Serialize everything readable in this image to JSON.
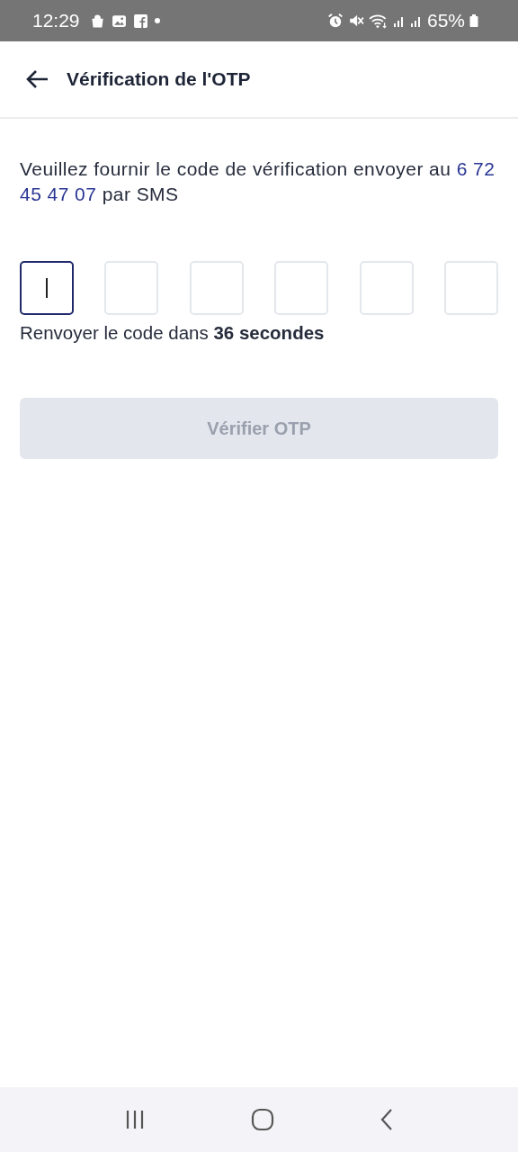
{
  "status_bar": {
    "time": "12:29",
    "battery": "65%"
  },
  "header": {
    "title": "Vérification de l'OTP"
  },
  "message": {
    "text": "Veuillez fournir le code de vérification envoyer au",
    "phone": "6 72 45 47 07",
    "suffix": "par SMS"
  },
  "otp_boxes": [
    {
      "focused": true
    },
    {
      "focused": false
    },
    {
      "focused": false
    },
    {
      "focused": false
    },
    {
      "focused": false
    },
    {
      "focused": false
    }
  ],
  "resend": "Renvoyer le code dans **36 secondes**",
  "verify_button": {
    "label": "Vérifier OTP",
    "disabled": true
  }
}
